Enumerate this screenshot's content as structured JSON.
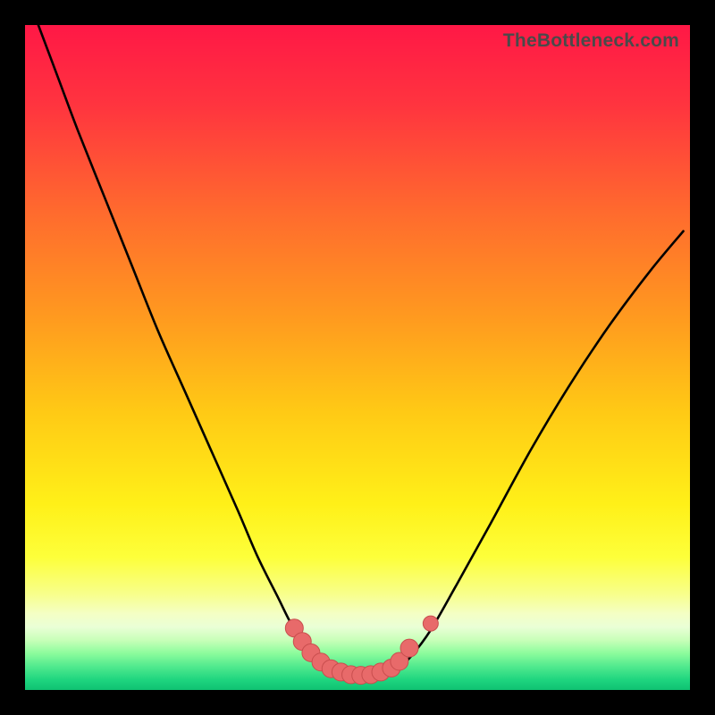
{
  "watermark": "TheBottleneck.com",
  "colors": {
    "frame": "#000000",
    "curve": "#000000",
    "marker_fill": "#e86a6a",
    "marker_stroke": "#c94e4e",
    "grad_stops": [
      {
        "offset": 0.0,
        "color": "#ff1846"
      },
      {
        "offset": 0.12,
        "color": "#ff343f"
      },
      {
        "offset": 0.28,
        "color": "#ff6a2e"
      },
      {
        "offset": 0.44,
        "color": "#ff9a1f"
      },
      {
        "offset": 0.58,
        "color": "#ffc915"
      },
      {
        "offset": 0.72,
        "color": "#fff018"
      },
      {
        "offset": 0.8,
        "color": "#fdff3a"
      },
      {
        "offset": 0.855,
        "color": "#f8ff8a"
      },
      {
        "offset": 0.885,
        "color": "#f4ffc4"
      },
      {
        "offset": 0.905,
        "color": "#eaffd6"
      },
      {
        "offset": 0.925,
        "color": "#c8ffb9"
      },
      {
        "offset": 0.945,
        "color": "#8cfc9c"
      },
      {
        "offset": 0.965,
        "color": "#50e98e"
      },
      {
        "offset": 0.985,
        "color": "#1ed57f"
      },
      {
        "offset": 1.0,
        "color": "#0fc172"
      }
    ]
  },
  "chart_data": {
    "type": "line",
    "title": "",
    "xlabel": "",
    "ylabel": "",
    "xlim": [
      0,
      100
    ],
    "ylim": [
      0,
      100
    ],
    "series": [
      {
        "name": "bottleneck-curve",
        "x": [
          2,
          5,
          8,
          12,
          16,
          20,
          24,
          28,
          32,
          35,
          38,
          40,
          42,
          44,
          46,
          48,
          51,
          54,
          56,
          58,
          61,
          65,
          70,
          76,
          82,
          88,
          94,
          99
        ],
        "y": [
          100,
          92,
          84,
          74,
          64,
          54,
          45,
          36,
          27,
          20,
          14,
          10,
          7,
          5,
          3.5,
          2.7,
          2.2,
          2.4,
          3.2,
          5,
          9,
          16,
          25,
          36,
          46,
          55,
          63,
          69
        ]
      }
    ],
    "markers": {
      "name": "highlight-region",
      "x": [
        40.5,
        41.7,
        43.0,
        44.5,
        46.0,
        47.5,
        49.0,
        50.5,
        52.0,
        53.5,
        55.1,
        56.3,
        57.8
      ],
      "y": [
        9.3,
        7.3,
        5.6,
        4.2,
        3.2,
        2.7,
        2.3,
        2.2,
        2.3,
        2.7,
        3.3,
        4.3,
        6.3
      ]
    },
    "markers_extra": {
      "x": [
        61.0
      ],
      "y": [
        10.0
      ]
    }
  }
}
